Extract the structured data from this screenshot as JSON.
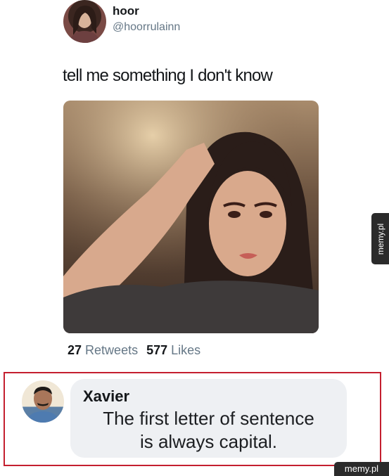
{
  "tweet": {
    "display_name": "hoor",
    "handle": "@hoorrulainn",
    "text": "tell me something I don't know",
    "retweets_count": "27",
    "retweets_label": "Retweets",
    "likes_count": "577",
    "likes_label": "Likes",
    "photo_icon": "portrait-photo-icon"
  },
  "reply": {
    "name": "Xavier",
    "text_line1": "The first letter of sentence",
    "text_line2": "is always capital."
  },
  "site": {
    "side_badge": "memy.pl",
    "watermark": "memy.pl"
  },
  "colors": {
    "reply_border": "#c41f2f",
    "bubble_bg": "#eef0f3",
    "secondary_text": "#657786",
    "badge_bg": "#2b2b2b"
  }
}
